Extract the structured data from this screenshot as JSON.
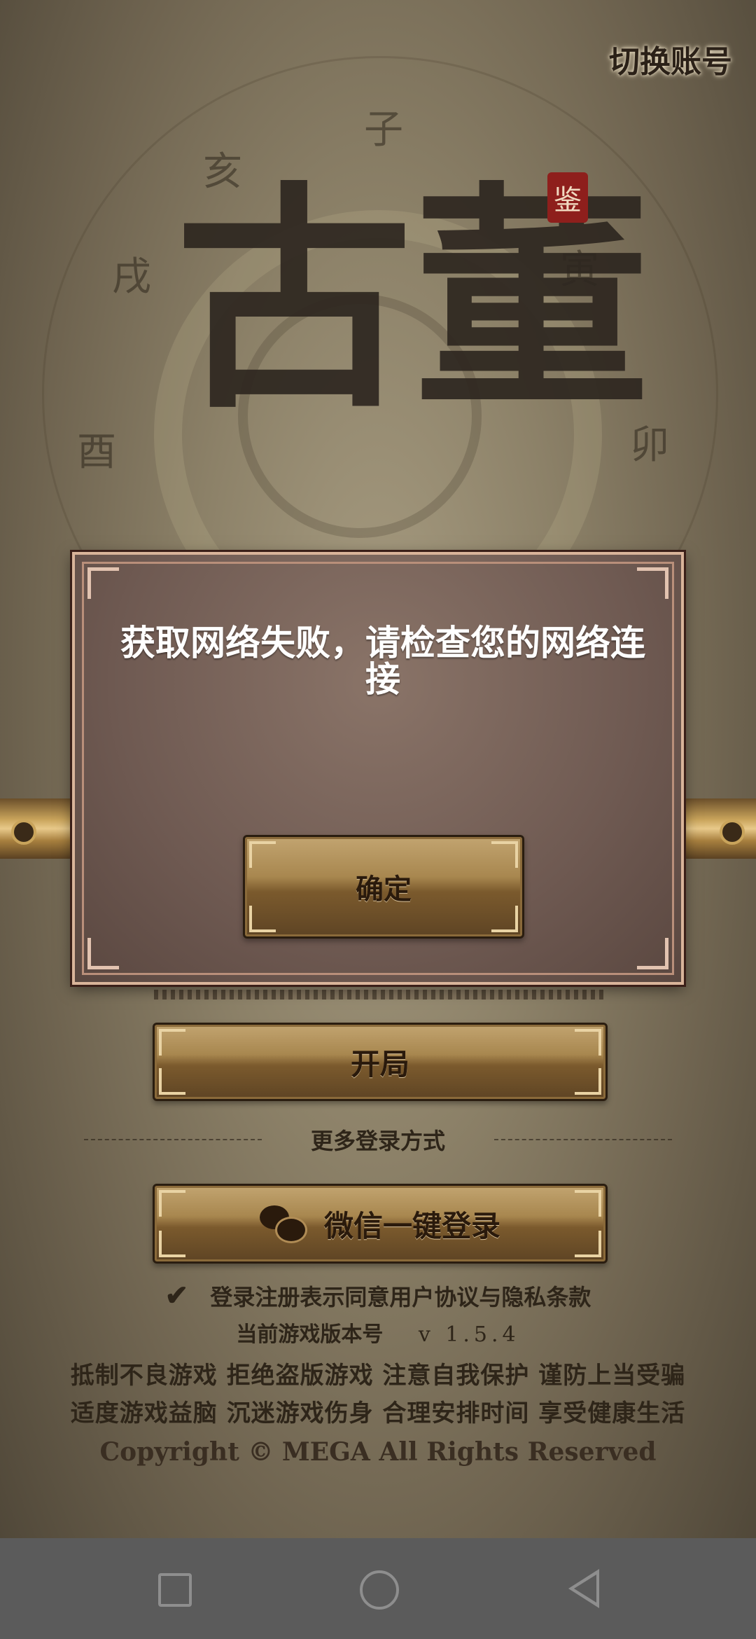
{
  "header": {
    "switch_account": "切换账号"
  },
  "background": {
    "zodiac": [
      "子",
      "亥",
      "戌",
      "寅",
      "酉",
      "卯"
    ],
    "logo_top": "古董",
    "seal": "鉴"
  },
  "dialog": {
    "message": "获取网络失败，请检查您的网络连接",
    "confirm_label": "确定"
  },
  "main": {
    "start_label": "开局",
    "more_login": "更多登录方式",
    "wechat_label": "微信一键登录",
    "agreement": "登录注册表示同意用户协议与隐私条款",
    "version_label": "当前游戏版本号",
    "version_value": "v 1.5.4",
    "notice_line1": "抵制不良游戏 拒绝盗版游戏 注意自我保护 谨防上当受骗",
    "notice_line2": "适度游戏益脑 沉迷游戏伤身 合理安排时间 享受健康生活",
    "copyright": "Copyright © MEGA All Rights Reserved"
  },
  "icons": {
    "check": "checkmark-icon",
    "wechat": "wechat-icon",
    "nav_recents": "square-icon",
    "nav_home": "circle-icon",
    "nav_back": "triangle-back-icon"
  },
  "colors": {
    "dialog_bg": "#6f5a52",
    "button_gold": "#a8874f",
    "nav_bar": "#5b5b5b"
  }
}
